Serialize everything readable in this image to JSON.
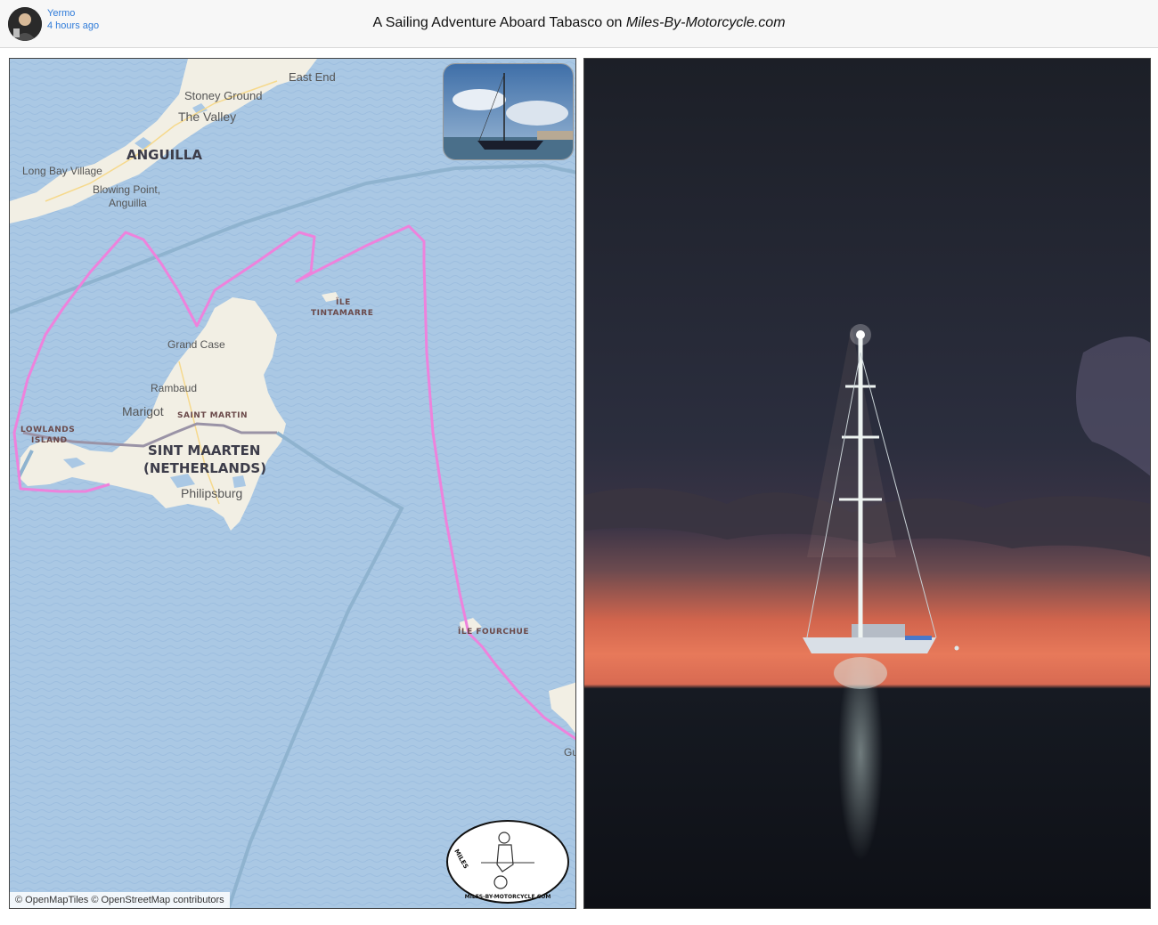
{
  "post": {
    "author": "Yermo",
    "time_ago": "4 hours ago",
    "title_prefix": "A Sailing Adventure Aboard Tabasco on ",
    "title_site": "Miles-By-Motorcycle.com"
  },
  "map": {
    "labels": {
      "east_end": "East End",
      "stoney_ground": "Stoney Ground",
      "the_valley": "The Valley",
      "anguilla": "ANGUILLA",
      "long_bay_village": "Long Bay Village",
      "blowing_point_1": "Blowing Point,",
      "blowing_point_2": "Anguilla",
      "ile_tintamarre_1": "ÎLE",
      "ile_tintamarre_2": "TINTAMARRE",
      "grand_case": "Grand Case",
      "rambaud": "Rambaud",
      "marigot": "Marigot",
      "saint_martin": "SAINT MARTIN",
      "lowlands_1": "LOWLANDS",
      "lowlands_2": "ISLAND",
      "sint_maarten_1": "SINT MAARTEN",
      "sint_maarten_2": "(NETHERLANDS)",
      "philipsburg": "Philipsburg",
      "ile_fourchue": "ÎLE FOURCHUE",
      "gu": "Gu"
    },
    "attribution": "© OpenMapTiles © OpenStreetMap contributors",
    "logo_text": "MILES-BY-MOTORCYCLE.COM",
    "colors": {
      "sea": "#aac8e4",
      "land": "#f2efe4",
      "track": "#ee82dc",
      "ferry": "#8fb3cf",
      "border": "#9a93a6"
    }
  }
}
